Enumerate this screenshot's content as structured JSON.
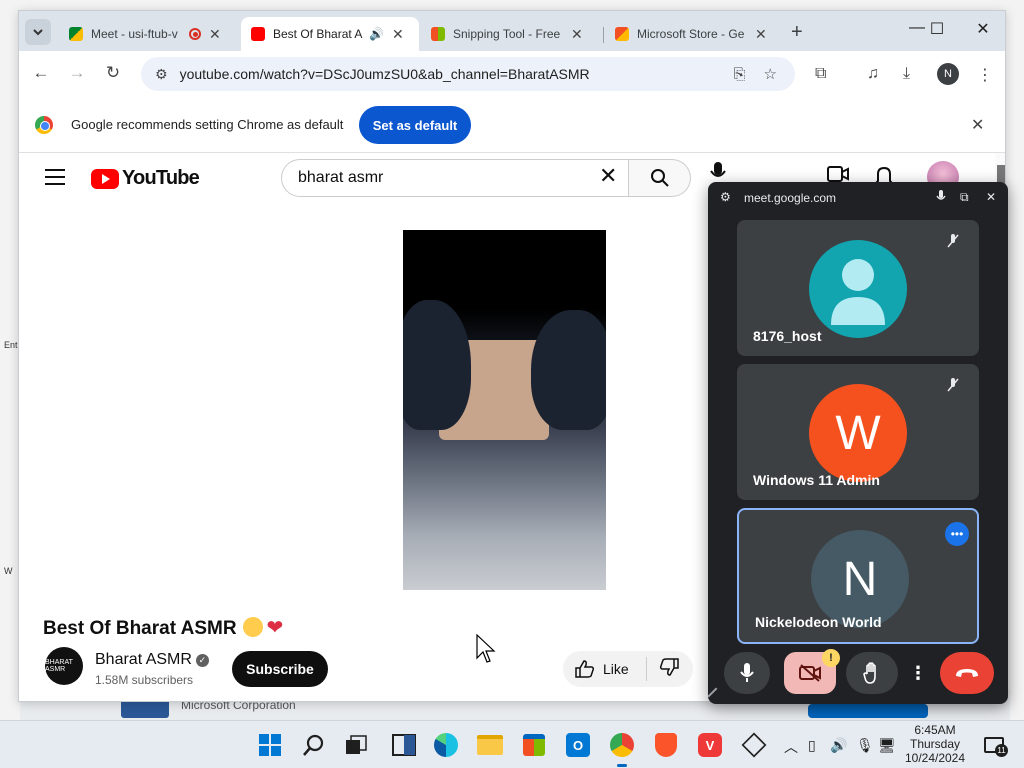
{
  "desktop": {
    "left_text_1": "Ent",
    "left_text_2": "W",
    "bottom_text": "Microsoft Corporation"
  },
  "browser": {
    "tabs": [
      {
        "label": "Meet - usi-ftub-v",
        "favicon": "google-meet-icon",
        "recording": true
      },
      {
        "label": "Best Of Bharat A",
        "favicon": "youtube-icon",
        "audio": true,
        "active": true
      },
      {
        "label": "Snipping Tool - Free",
        "favicon": "ms-store-icon"
      },
      {
        "label": "Microsoft Store - Ge",
        "favicon": "bing-icon"
      }
    ],
    "url": "youtube.com/watch?v=DScJ0umzSU0&ab_channel=BharatASMR",
    "profile_initial": "N",
    "infobar": {
      "message": "Google recommends setting Chrome as default",
      "button": "Set as default"
    }
  },
  "youtube": {
    "logo_text": "YouTube",
    "search_query": "bharat asmr",
    "video_title": "Best Of Bharat ASMR",
    "channel": {
      "name": "Bharat ASMR",
      "subscribers": "1.58M subscribers",
      "avatar_text": "BHARAT ASMR"
    },
    "subscribe_label": "Subscribe",
    "like_label": "Like"
  },
  "meet_pip": {
    "url": "meet.google.com",
    "participants": [
      {
        "name": "8176_host",
        "initial": "",
        "color": "#12a4af",
        "muted": true
      },
      {
        "name": "Windows 11 Admin",
        "initial": "W",
        "color": "#f4511e",
        "muted": true
      },
      {
        "name": "Nickelodeon World",
        "initial": "N",
        "color": "#455a64",
        "muted": false,
        "active": true
      }
    ],
    "warning_badge": "!"
  },
  "taskbar": {
    "time": "6:45AM",
    "day": "Thursday",
    "date": "10/24/2024",
    "notification_count": "11"
  },
  "colors": {
    "chrome_blue": "#0b57d0",
    "youtube_red": "#ff0000",
    "meet_bg": "#202124",
    "end_call_red": "#ea4335"
  }
}
